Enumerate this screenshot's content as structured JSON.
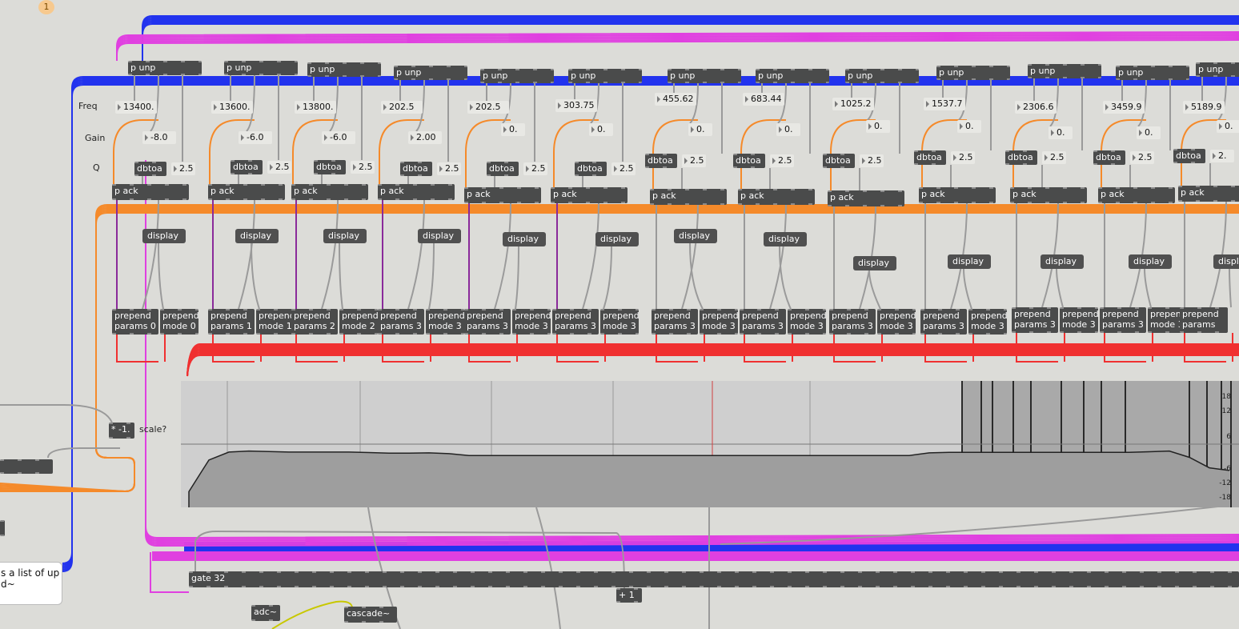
{
  "badge": "1",
  "row_labels": {
    "freq": "Freq",
    "gain": "Gain",
    "q": "Q"
  },
  "bands": [
    {
      "unpack": "p unp",
      "freq": "13400.",
      "gain": "-8.0",
      "dbtoa": "dbtoa",
      "q": "2.5",
      "pack": "p ack",
      "display": "display",
      "prepend_params": [
        "prepend",
        "params 0"
      ],
      "prepend_mode": [
        "prepend",
        "mode 0"
      ]
    },
    {
      "unpack": "p unp",
      "freq": "13600.",
      "gain": "-6.0",
      "dbtoa": "dbtoa",
      "q": "2.5",
      "pack": "p ack",
      "display": "display",
      "prepend_params": [
        "prepend",
        "params 1"
      ],
      "prepend_mode": [
        "prepend",
        "mode 1"
      ]
    },
    {
      "unpack": "p unp",
      "freq": "13800.",
      "gain": "-6.0",
      "dbtoa": "dbtoa",
      "q": "2.5",
      "pack": "p ack",
      "display": "display",
      "prepend_params": [
        "prepend",
        "params 2"
      ],
      "prepend_mode": [
        "prepend",
        "mode 2"
      ]
    },
    {
      "unpack": "p unp",
      "freq": "202.5",
      "gain": "2.00",
      "dbtoa": "dbtoa",
      "q": "2.5",
      "pack": "p ack",
      "display": "display",
      "prepend_params": [
        "prepend",
        "params 3"
      ],
      "prepend_mode": [
        "prepend",
        "mode 3"
      ]
    },
    {
      "unpack": "p unp",
      "freq": "202.5",
      "gain": "0.",
      "dbtoa": "dbtoa",
      "q": "2.5",
      "pack": "p ack",
      "display": "display",
      "prepend_params": [
        "prepend",
        "params 3"
      ],
      "prepend_mode": [
        "prepend",
        "mode 3"
      ]
    },
    {
      "unpack": "p unp",
      "freq": "303.75",
      "gain": "0.",
      "dbtoa": "dbtoa",
      "q": "2.5",
      "pack": "p ack",
      "display": "display",
      "prepend_params": [
        "prepend",
        "params 3"
      ],
      "prepend_mode": [
        "prepend",
        "mode 3"
      ]
    },
    {
      "unpack": "p unp",
      "freq": "455.62",
      "gain": "0.",
      "dbtoa": "dbtoa",
      "q": "2.5",
      "pack": "p ack",
      "display": "display",
      "prepend_params": [
        "prepend",
        "params 3"
      ],
      "prepend_mode": [
        "prepend",
        "mode 3"
      ]
    },
    {
      "unpack": "p unp",
      "freq": "683.44",
      "gain": "0.",
      "dbtoa": "dbtoa",
      "q": "2.5",
      "pack": "p ack",
      "display": "display",
      "prepend_params": [
        "prepend",
        "params 3"
      ],
      "prepend_mode": [
        "prepend",
        "mode 3"
      ]
    },
    {
      "unpack": "p unp",
      "freq": "1025.2",
      "gain": "0.",
      "dbtoa": "dbtoa",
      "q": "2.5",
      "pack": "p ack",
      "display": "display",
      "prepend_params": [
        "prepend",
        "params 3"
      ],
      "prepend_mode": [
        "prepend",
        "mode 3"
      ]
    },
    {
      "unpack": "p unp",
      "freq": "1537.7",
      "gain": "0.",
      "dbtoa": "dbtoa",
      "q": "2.5",
      "pack": "p ack",
      "display": "display",
      "prepend_params": [
        "prepend",
        "params 3"
      ],
      "prepend_mode": [
        "prepend",
        "mode 3"
      ]
    },
    {
      "unpack": "p unp",
      "freq": "2306.6",
      "gain": "0.",
      "dbtoa": "dbtoa",
      "q": "2.5",
      "pack": "p ack",
      "display": "display",
      "prepend_params": [
        "prepend",
        "params 3"
      ],
      "prepend_mode": [
        "prepend",
        "mode 3"
      ]
    },
    {
      "unpack": "p unp",
      "freq": "3459.9",
      "gain": "0.",
      "dbtoa": "dbtoa",
      "q": "2.5",
      "pack": "p ack",
      "display": "display",
      "prepend_params": [
        "prepend",
        "params 3"
      ],
      "prepend_mode": [
        "prepend",
        "mode 3"
      ]
    },
    {
      "unpack": "p unp",
      "freq": "5189.9",
      "gain": "0.",
      "dbtoa": "dbtoa",
      "q": "2.",
      "pack": "p ack",
      "display": "display",
      "prepend_params": [
        "prepend",
        "params"
      ],
      "prepend_mode": []
    }
  ],
  "scale_obj": "* -1.",
  "scale_label": "scale?",
  "gate": "gate 32",
  "plus_one": "+ 1",
  "adc": "adc~",
  "cascade": "cascade~",
  "comment": [
    "s a list of up",
    "d~"
  ],
  "graph": {
    "axis_ticks": [
      "18",
      "12",
      "6",
      "-6",
      "-12",
      "-18"
    ],
    "curve_db": [
      -18,
      -6,
      -3,
      -2.6,
      -2.8,
      -3,
      -3,
      -3,
      -3,
      -3.2,
      -3.4,
      -3.4,
      -3.3,
      -3.6,
      -4.3,
      -4.3,
      -4.3,
      -4.3,
      -4.3,
      -4.3,
      -4.3,
      -4.3,
      -4.3,
      -4.3,
      -4.3,
      -4.3,
      -4.3,
      -4.3,
      -4.3,
      -4.3,
      -4.3,
      -4.3,
      -4.3,
      -4.3,
      -4.3,
      -4.3,
      -4.3,
      -3.3,
      -3.1,
      -3.1,
      -3.1,
      -3.1,
      -3.1,
      -3.1,
      -3.1,
      -3.1,
      -3.1,
      -3.1,
      -2.9,
      -2.6,
      -5,
      -9,
      -10
    ]
  },
  "colors": {
    "blue": "#2233ee",
    "magenta": "#e040e0",
    "orange": "#f58a2a",
    "red": "#f03030",
    "grey": "#9a9a9a",
    "purple": "#8a2a9a"
  }
}
